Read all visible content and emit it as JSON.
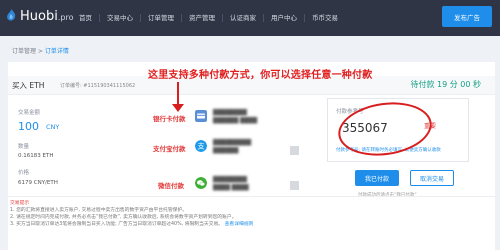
{
  "header": {
    "logo_text": "Huobi",
    "logo_suffix": ".pro",
    "nav": [
      "首页",
      "交易中心",
      "订单管理",
      "资产管理",
      "认证商家",
      "用户中心",
      "币币交易"
    ],
    "publish_button": "发布广告"
  },
  "breadcrumb": {
    "parent": "订单管理",
    "separator": " > ",
    "current": "订单详情"
  },
  "order": {
    "title": "买入 ETH",
    "number_label": "订单编号: #115190341115062",
    "countdown": "待付款 19 分 00 秒"
  },
  "fields": {
    "amount_label": "交易金额",
    "amount_value": "100",
    "amount_unit": "CNY",
    "quantity_label": "数量",
    "quantity_value": "0.16183 ETH",
    "price_label": "价格",
    "price_value": "6179 CNY/ETH"
  },
  "payments": [
    {
      "label": "银行卡付款",
      "icon": "bank-card-icon",
      "line1": "████████",
      "line2": "██████ ████"
    },
    {
      "label": "支付宝付款",
      "icon": "alipay-icon",
      "line1": "█████████",
      "line2": "██████"
    },
    {
      "label": "微信付款",
      "icon": "wechat-icon",
      "line1": "████████",
      "line2": "████ ████"
    }
  ],
  "annotation": "这里支持多种付款方式，你可以选择任意一种付款",
  "reference": {
    "label": "付款参考号",
    "value": "355067",
    "note": "重要",
    "hint": "付款参考号: 请在转账时务必填写, 以便卖方确认收款"
  },
  "actions": {
    "paid_button": "我已付款",
    "cancel_button": "取消交易",
    "after_pay_hint": "付款成功后请点击“我已付款”"
  },
  "tips": {
    "title": "交易提示",
    "lines": [
      "1. 您的汇款将直接进入卖方账户, 交易过程中卖方出售的数字资产由平台托管保护。",
      "2. 请在规定时间内完成付款, 并务必点击“我已付款”, 卖方确认收款后, 系统会将数字资产划转到您的账户。",
      "3. 买方当日取消订单达3笔将会限制当日买入功能; 广告方当日取消订单超过40%, 将限制当天交易。"
    ],
    "link": "查看详细规则"
  },
  "colors": {
    "topbar": "#2f3544",
    "accent": "#1e8eea",
    "annotation_red": "#e02020",
    "countdown_green": "#16a085"
  }
}
